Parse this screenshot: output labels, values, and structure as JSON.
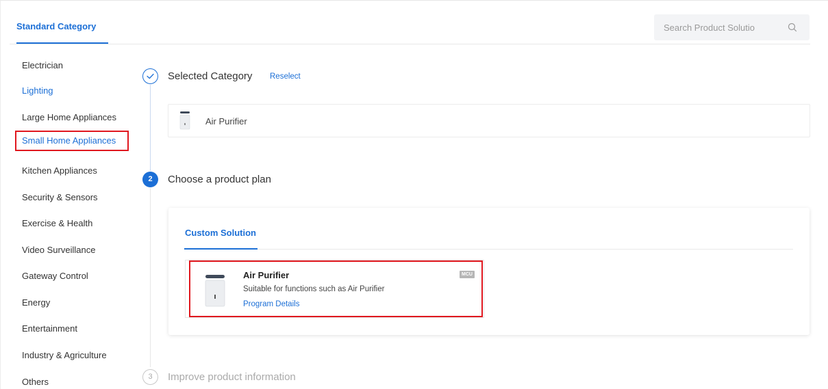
{
  "header": {
    "tab_label": "Standard Category",
    "search_placeholder": "Search Product Solutio"
  },
  "sidebar": {
    "items": [
      {
        "label": "Electrician"
      },
      {
        "label": "Lighting"
      },
      {
        "label": "Large Home Appliances"
      },
      {
        "label": "Small Home Appliances"
      },
      {
        "label": "Kitchen Appliances"
      },
      {
        "label": "Security & Sensors"
      },
      {
        "label": "Exercise & Health"
      },
      {
        "label": "Video Surveillance"
      },
      {
        "label": "Gateway Control"
      },
      {
        "label": "Energy"
      },
      {
        "label": "Entertainment"
      },
      {
        "label": "Industry & Agriculture"
      },
      {
        "label": "Others"
      }
    ]
  },
  "steps": {
    "step1": {
      "title": "Selected Category",
      "action": "Reselect",
      "selected": "Air Purifier"
    },
    "step2": {
      "number": "2",
      "title": "Choose a product plan"
    },
    "step3": {
      "number": "3",
      "title": "Improve product information"
    }
  },
  "plan": {
    "tab_label": "Custom Solution",
    "solution": {
      "title": "Air Purifier",
      "description": "Suitable for functions such as Air Purifier",
      "link": "Program Details",
      "badge": "MCU"
    }
  },
  "colors": {
    "accent": "#1c6fd6",
    "highlight": "#e0171e"
  }
}
